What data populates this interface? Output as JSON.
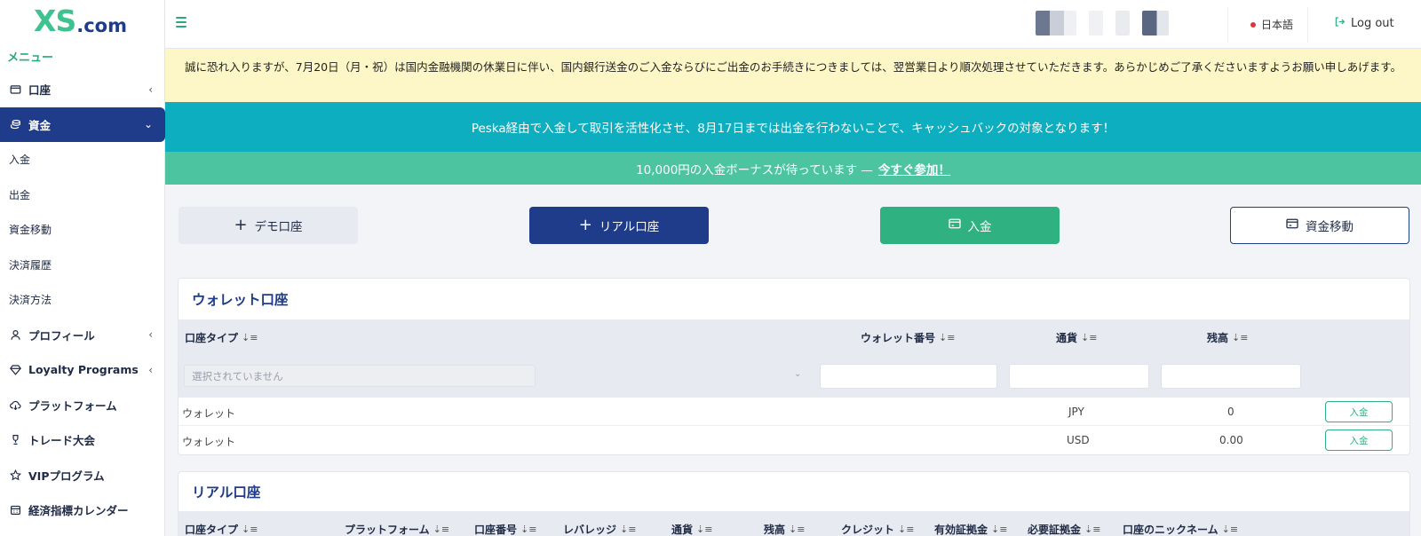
{
  "brand": {
    "logo_main": "XS",
    "logo_suffix": ".com"
  },
  "sidebar": {
    "menu_title": "メニュー",
    "items": [
      {
        "label": "口座",
        "icon": "wallet-icon",
        "expandable": true,
        "expanded": false
      },
      {
        "label": "資金",
        "icon": "coins-icon",
        "expandable": true,
        "expanded": true,
        "active": true
      },
      {
        "label": "入金",
        "sub": true
      },
      {
        "label": "出金",
        "sub": true
      },
      {
        "label": "資金移動",
        "sub": true
      },
      {
        "label": "決済履歴",
        "sub": true
      },
      {
        "label": "決済方法",
        "sub": true
      },
      {
        "label": "プロフィール",
        "icon": "user-icon",
        "expandable": true
      },
      {
        "label": "Loyalty Programs",
        "icon": "diamond-icon",
        "expandable": true
      },
      {
        "label": "プラットフォーム",
        "icon": "cloud-download-icon"
      },
      {
        "label": "トレード大会",
        "icon": "trophy-icon"
      },
      {
        "label": "VIPプログラム",
        "icon": "star-icon"
      },
      {
        "label": "経済指標カレンダー",
        "icon": "calendar-icon"
      }
    ]
  },
  "topbar": {
    "language": "日本語",
    "logout": "Log out"
  },
  "banners": {
    "notice": "誠に恐れ入りますが、7月20日（月・祝）は国内金融機関の休業日に伴い、国内銀行送金のご入金ならびにご出金のお手続きにつきましては、翌営業日より順次処理させていただきます。あらかじめご了承くださいますようお願い申しあげます。",
    "promo": "Peska経由で入金して取引を活性化させ、8月17日までは出金を行わないことで、キャッシュバックの対象となります！",
    "bonus_text": "10,000円の入金ボーナスが待っています —",
    "bonus_link": "今すぐ参加！"
  },
  "actions": {
    "demo": "デモ口座",
    "real": "リアル口座",
    "deposit": "入金",
    "transfer": "資金移動"
  },
  "wallet_section": {
    "title": "ウォレット口座",
    "headers": {
      "type": "口座タイプ",
      "number": "ウォレット番号",
      "currency": "通貨",
      "balance": "残高"
    },
    "filter_placeholder": "選択されていません",
    "rows": [
      {
        "type": "ウォレット",
        "currency": "JPY",
        "balance": "0",
        "action": "入金"
      },
      {
        "type": "ウォレット",
        "currency": "USD",
        "balance": "0.00",
        "action": "入金"
      }
    ]
  },
  "real_section": {
    "title": "リアル口座",
    "headers": [
      "口座タイプ",
      "プラットフォーム",
      "口座番号",
      "レバレッジ",
      "通貨",
      "残高",
      "クレジット",
      "有効証拠金",
      "必要証拠金",
      "口座のニックネーム"
    ]
  },
  "colors": {
    "primary": "#1f3c8a",
    "green": "#2fb182",
    "teal": "#0daec0",
    "notice_bg": "#fdf6c6"
  }
}
